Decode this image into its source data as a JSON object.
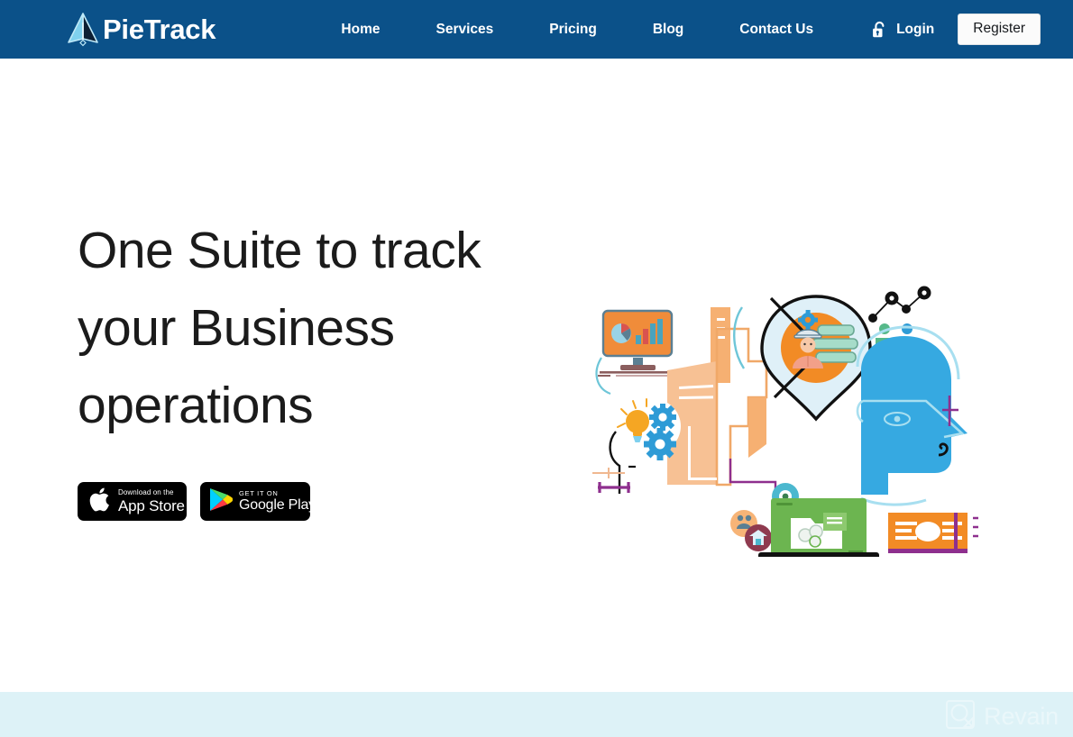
{
  "theme": {
    "header_bg": "#0b5189",
    "accent_orange": "#f28b25",
    "accent_blue": "#36a9e1",
    "band_bg": "#ddf2f7",
    "heading_color": "#1b1b1b"
  },
  "header": {
    "brand": {
      "name": "PieTrack",
      "logo_icon": "paper-plane-triangle-icon"
    },
    "nav_links": [
      {
        "label": "Home"
      },
      {
        "label": "Services"
      },
      {
        "label": "Pricing"
      },
      {
        "label": "Blog"
      },
      {
        "label": "Contact Us"
      }
    ],
    "login": {
      "label": "Login",
      "icon": "unlock-padlock-icon"
    },
    "register": {
      "label": "Register"
    }
  },
  "hero": {
    "title": "One Suite to track your Business operations",
    "badges": [
      {
        "icon": "apple-logo-icon",
        "small_text": "Download on the",
        "big_text": "App Store"
      },
      {
        "icon": "google-play-triangle-icon",
        "small_text": "GET IT ON",
        "big_text": "Google Play"
      }
    ],
    "illustration": {
      "alt": "business-operations-illustration",
      "elements": [
        "desktop-monitor-with-pie-and-bar-chart",
        "orange-office-building",
        "map-pin-with-worker-and-gear",
        "blue-head-profile",
        "network-scatter-dots",
        "two-people-icons",
        "lightbulb-with-gears",
        "green-laptop-with-folder",
        "orange-card"
      ]
    }
  },
  "footer_band": {
    "watermark": {
      "text": "Revain",
      "icon": "revain-logo-icon"
    }
  }
}
